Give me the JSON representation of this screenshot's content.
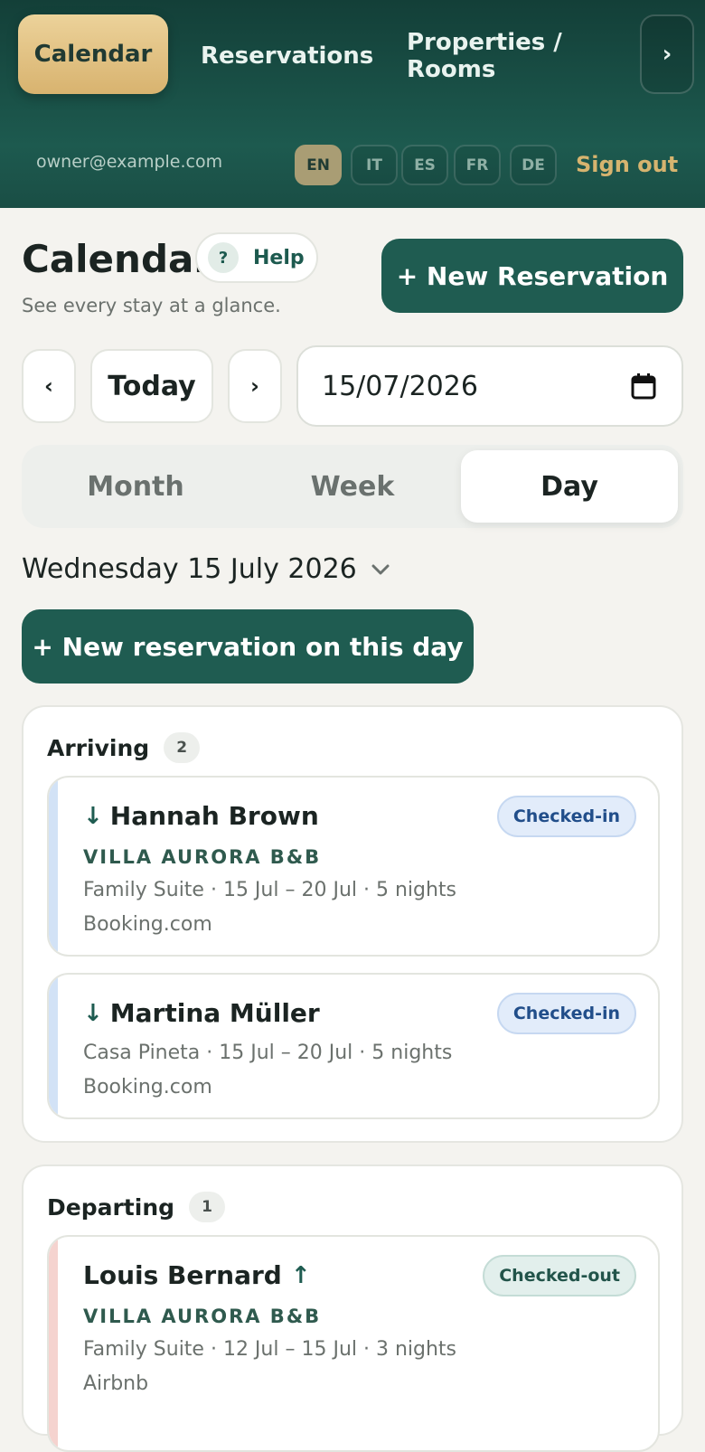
{
  "nav": {
    "calendar": "Calendar",
    "reservations": "Reservations",
    "properties": "Properties / Rooms",
    "more": "›"
  },
  "account": {
    "email": "owner@example.com",
    "languages": [
      "EN",
      "IT",
      "ES",
      "FR",
      "DE"
    ],
    "active_language": "EN",
    "sign_out": "Sign out"
  },
  "header": {
    "title": "Calendar",
    "help_icon": "?",
    "help_label": "Help",
    "subtitle": "See every stay at a glance.",
    "new_reservation": "+ New Reservation"
  },
  "controls": {
    "prev": "‹",
    "today": "Today",
    "next": "›",
    "date_value": "15/07/2026",
    "date_icon": "calendar-icon"
  },
  "views": {
    "options": [
      "Month",
      "Week",
      "Day"
    ],
    "selected": "Day"
  },
  "day": {
    "label": "Wednesday 15 July 2026",
    "new_on_day": "+ New reservation on this day"
  },
  "arriving": {
    "title": "Arriving",
    "count": "2",
    "items": [
      {
        "guest": "Hannah Brown",
        "arrow": "↓",
        "status": "Checked-in",
        "property": "VILLA AURORA B&B",
        "details": "Family Suite · 15 Jul – 20 Jul · 5 nights",
        "source": "Booking.com"
      },
      {
        "guest": "Martina Müller",
        "arrow": "↓",
        "status": "Checked-in",
        "details": "Casa Pineta · 15 Jul – 20 Jul · 5 nights",
        "source": "Booking.com"
      }
    ]
  },
  "departing": {
    "title": "Departing",
    "count": "1",
    "items": [
      {
        "guest": "Louis Bernard",
        "arrow": "↑",
        "status": "Checked-out",
        "property": "VILLA AURORA B&B",
        "details": "Family Suite · 12 Jul – 15 Jul · 3 nights",
        "source": "Airbnb"
      }
    ]
  },
  "colors": {
    "brand": "#1f5c51",
    "accent": "#d8b36f",
    "checked_in": "#214e8a",
    "checked_out": "#22544a"
  }
}
